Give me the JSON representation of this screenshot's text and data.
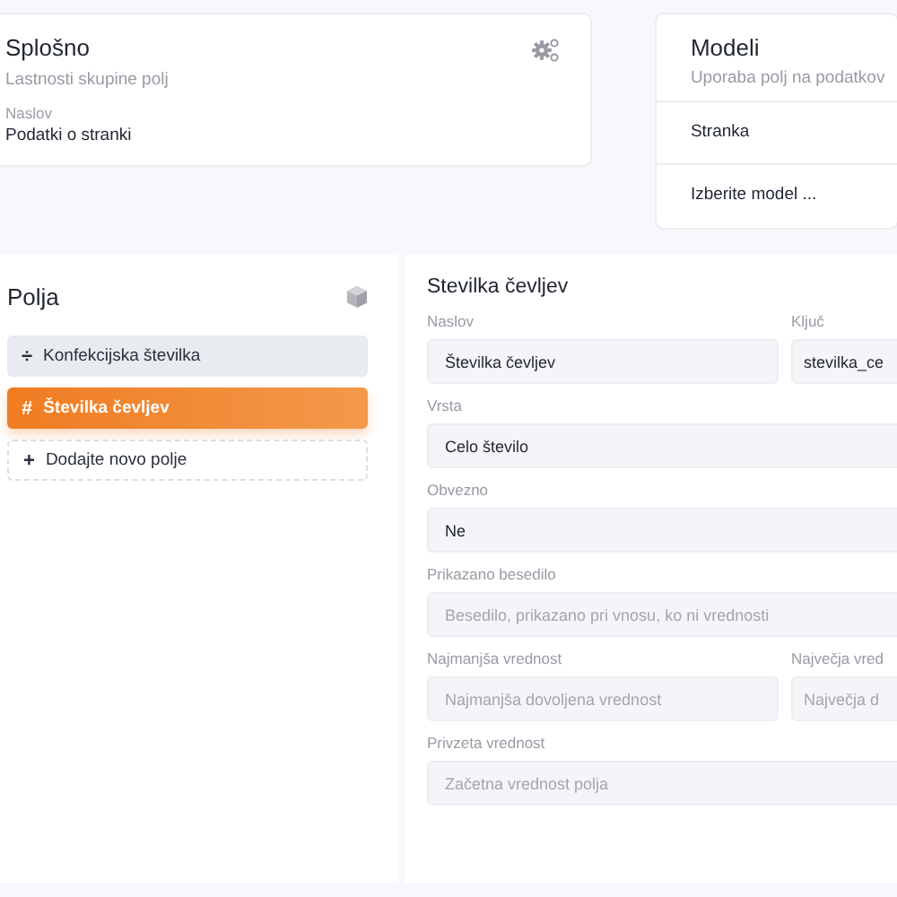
{
  "general": {
    "title": "Splošno",
    "subtitle": "Lastnosti skupine polj",
    "field_label": "Naslov",
    "field_value": "Podatki o stranki"
  },
  "models": {
    "title": "Modeli",
    "subtitle": "Uporaba polj na podatkov",
    "items": [
      "Stranka",
      "Izberite model ..."
    ]
  },
  "fields_panel": {
    "title": "Polja",
    "items": [
      {
        "kind": "field",
        "icon": "÷",
        "label": "Konfekcijska številka",
        "selected": false
      },
      {
        "kind": "field",
        "icon": "#",
        "label": "Številka čevljev",
        "selected": true
      },
      {
        "kind": "add",
        "icon": "+",
        "label": "Dodajte novo polje"
      }
    ]
  },
  "editor": {
    "title": "Stevilka čevljev",
    "rows": [
      [
        {
          "label": "Naslov",
          "value": "Številka čevljev"
        },
        {
          "label": "Ključ",
          "value": "stevilka_ce"
        }
      ],
      [
        {
          "label": "Vrsta",
          "value": "Celo število"
        }
      ],
      [
        {
          "label": "Obvezno",
          "value": "Ne"
        }
      ],
      [
        {
          "label": "Prikazano besedilo",
          "placeholder": "Besedilo, prikazano pri vnosu, ko ni vrednosti"
        }
      ],
      [
        {
          "label": "Najmanjša vrednost",
          "placeholder": "Najmanjša dovoljena vrednost"
        },
        {
          "label": "Največja vred",
          "placeholder": "Največja d"
        }
      ],
      [
        {
          "label": "Privzeta vrednost",
          "placeholder": "Začetna vrednost polja"
        }
      ]
    ]
  }
}
